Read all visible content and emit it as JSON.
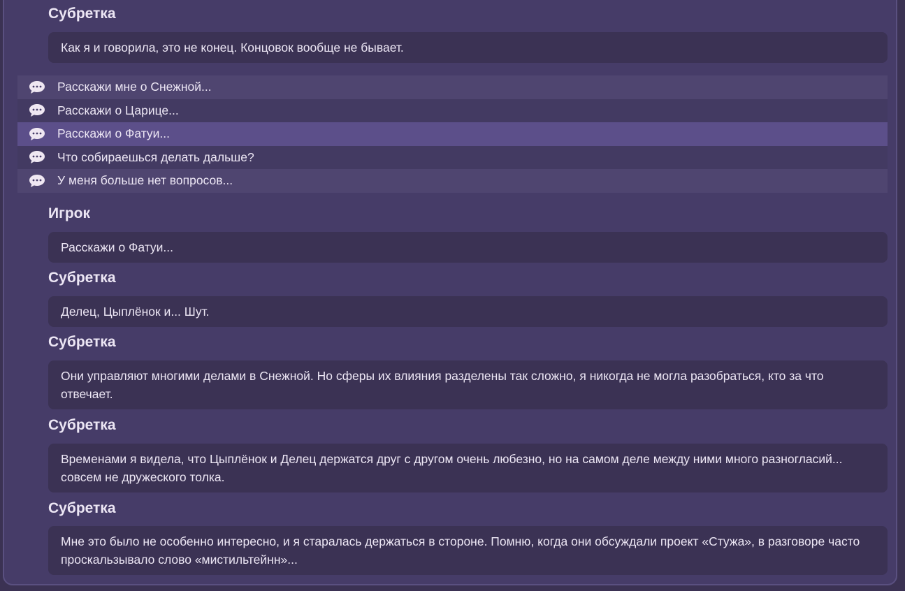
{
  "dialog_before": {
    "speaker": "Субретка",
    "text": "Как я и говорила, это не конец. Концовок вообще не бывает."
  },
  "choices": [
    {
      "label": "Расскажи мне о Снежной...",
      "selected": false
    },
    {
      "label": "Расскажи о Царице...",
      "selected": false
    },
    {
      "label": "Расскажи о Фатуи...",
      "selected": true
    },
    {
      "label": "Что собираешься делать дальше?",
      "selected": false
    },
    {
      "label": "У меня больше нет вопросов...",
      "selected": false
    }
  ],
  "dialog_after": [
    {
      "speaker": "Игрок",
      "text": "Расскажи о Фатуи..."
    },
    {
      "speaker": "Субретка",
      "text": "Делец, Цыплёнок и... Шут."
    },
    {
      "speaker": "Субретка",
      "text": "Они управляют многими делами в Снежной. Но сферы их влияния разделены так сложно, я никогда не могла разобраться, кто за что отвечает."
    },
    {
      "speaker": "Субретка",
      "text": "Временами я видела, что Цыплёнок и Делец держатся друг с другом очень любезно, но на самом деле между ними много разногласий... совсем не дружеского толка."
    },
    {
      "speaker": "Субретка",
      "text": "Мне это было не особенно интересно, и я старалась держаться в стороне. Помню, когда они обсуждали проект «Стужа», в разговоре часто проскальзывало слово «мистильтейнн»..."
    }
  ],
  "icons": {
    "choice_icon": "speech-bubble-icon"
  },
  "colors": {
    "panel_bg": "#463c68",
    "bubble_bg": "#3b3254",
    "choice_selected_bg": "#5c4f8a",
    "text": "#ece6f4"
  }
}
